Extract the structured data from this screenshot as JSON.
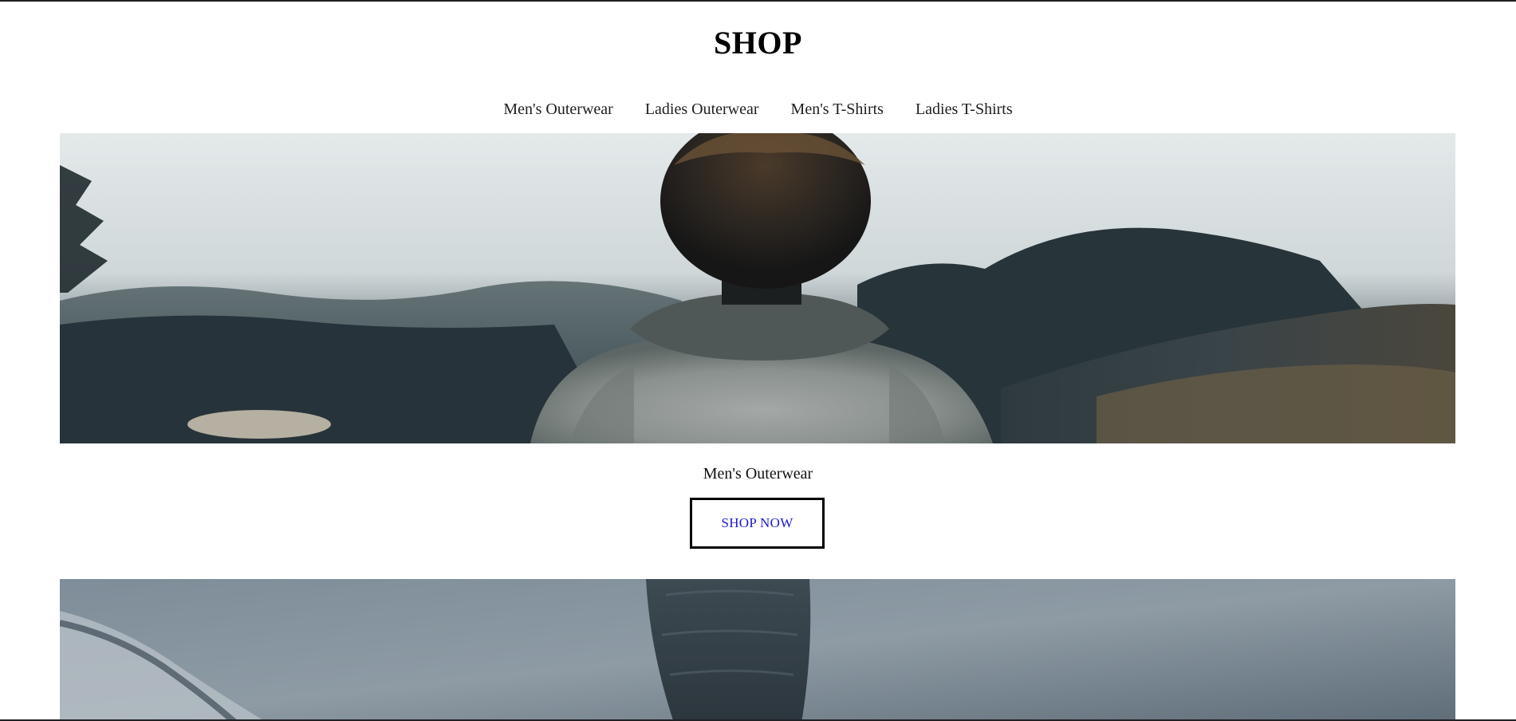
{
  "site": {
    "title": "SHOP"
  },
  "nav": {
    "items": [
      {
        "label": "Men's Outerwear"
      },
      {
        "label": "Ladies Outerwear"
      },
      {
        "label": "Men's T-Shirts"
      },
      {
        "label": "Ladies T-Shirts"
      }
    ]
  },
  "hero": {
    "category_label": "Men's Outerwear",
    "button_label": "SHOP NOW"
  },
  "colors": {
    "button_text": "#1a1acc",
    "button_border": "#000000",
    "title_text": "#000000"
  }
}
